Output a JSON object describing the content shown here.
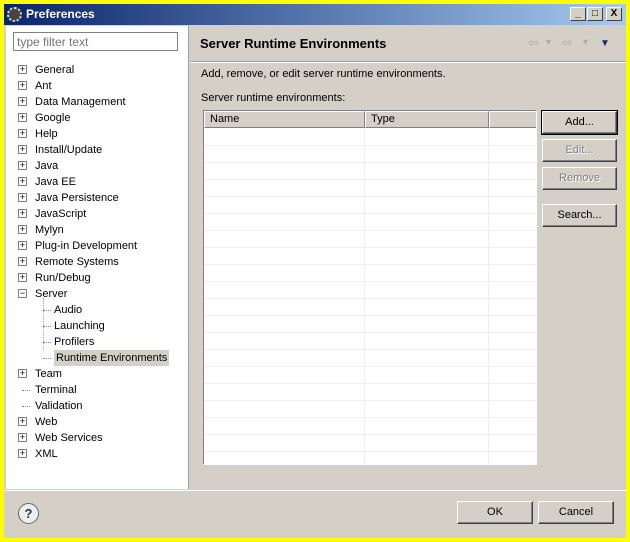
{
  "window": {
    "title": "Preferences",
    "minimize": "_",
    "maximize": "□",
    "close": "X"
  },
  "filter": {
    "placeholder": "type filter text"
  },
  "tree": [
    {
      "label": "General",
      "expander": "+",
      "level": 0
    },
    {
      "label": "Ant",
      "expander": "+",
      "level": 0
    },
    {
      "label": "Data Management",
      "expander": "+",
      "level": 0
    },
    {
      "label": "Google",
      "expander": "+",
      "level": 0
    },
    {
      "label": "Help",
      "expander": "+",
      "level": 0
    },
    {
      "label": "Install/Update",
      "expander": "+",
      "level": 0
    },
    {
      "label": "Java",
      "expander": "+",
      "level": 0
    },
    {
      "label": "Java EE",
      "expander": "+",
      "level": 0
    },
    {
      "label": "Java Persistence",
      "expander": "+",
      "level": 0
    },
    {
      "label": "JavaScript",
      "expander": "+",
      "level": 0
    },
    {
      "label": "Mylyn",
      "expander": "+",
      "level": 0
    },
    {
      "label": "Plug-in Development",
      "expander": "+",
      "level": 0
    },
    {
      "label": "Remote Systems",
      "expander": "+",
      "level": 0
    },
    {
      "label": "Run/Debug",
      "expander": "+",
      "level": 0
    },
    {
      "label": "Server",
      "expander": "−",
      "level": 0
    },
    {
      "label": "Audio",
      "expander": "",
      "level": 1
    },
    {
      "label": "Launching",
      "expander": "",
      "level": 1
    },
    {
      "label": "Profilers",
      "expander": "",
      "level": 1
    },
    {
      "label": "Runtime Environments",
      "expander": "",
      "level": 1,
      "selected": true
    },
    {
      "label": "Team",
      "expander": "+",
      "level": 0
    },
    {
      "label": "Terminal",
      "expander": "",
      "level": 0
    },
    {
      "label": "Validation",
      "expander": "",
      "level": 0
    },
    {
      "label": "Web",
      "expander": "+",
      "level": 0
    },
    {
      "label": "Web Services",
      "expander": "+",
      "level": 0
    },
    {
      "label": "XML",
      "expander": "+",
      "level": 0
    }
  ],
  "page": {
    "title": "Server Runtime Environments",
    "back": "⇦",
    "forward": "⇨",
    "dropdown": "▾",
    "menu": "▼",
    "description": "Add, remove, or edit server runtime environments.",
    "table_label": "Server runtime environments:",
    "columns": [
      "Name",
      "Type",
      ""
    ],
    "buttons": {
      "add": "Add...",
      "edit": "Edit...",
      "remove": "Remove",
      "search": "Search..."
    }
  },
  "footer": {
    "help": "?",
    "ok": "OK",
    "cancel": "Cancel"
  }
}
